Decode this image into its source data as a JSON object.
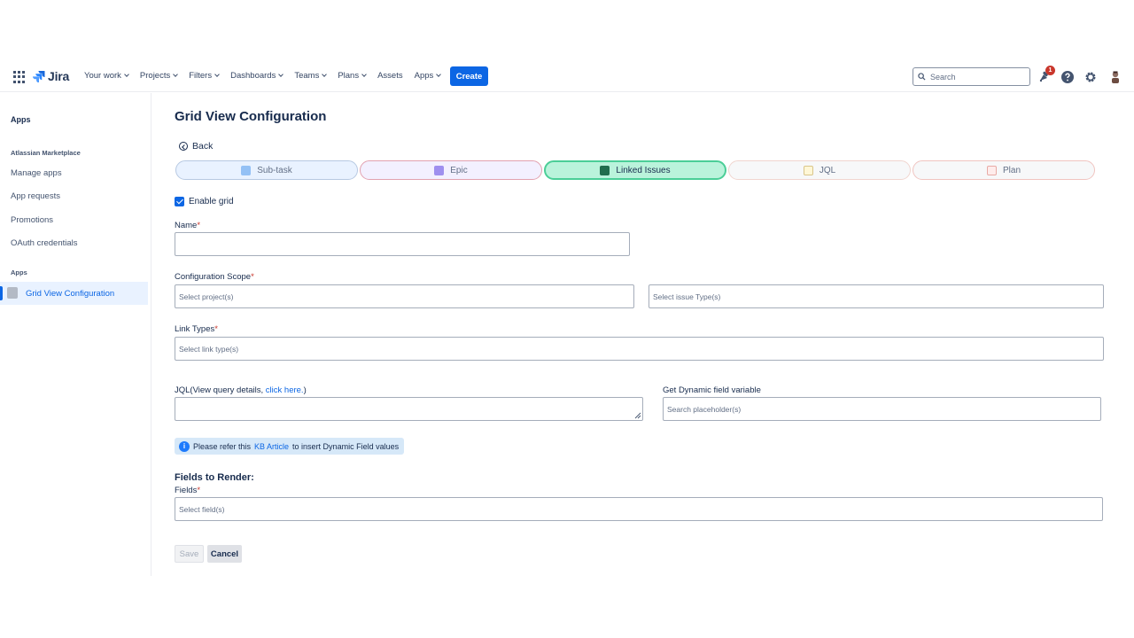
{
  "topnav": {
    "logo_text": "Jira",
    "items": [
      {
        "label": "Your work",
        "caret": true
      },
      {
        "label": "Projects",
        "caret": true
      },
      {
        "label": "Filters",
        "caret": true
      },
      {
        "label": "Dashboards",
        "caret": true
      },
      {
        "label": "Teams",
        "caret": true
      },
      {
        "label": "Plans",
        "caret": true
      },
      {
        "label": "Assets",
        "caret": false
      },
      {
        "label": "Apps",
        "caret": true
      }
    ],
    "create_label": "Create",
    "search_placeholder": "Search",
    "notification_count": "1",
    "icons": [
      "app-switcher-icon",
      "jira-logo-icon",
      "search-icon",
      "notifications-icon",
      "help-icon",
      "settings-icon",
      "avatar"
    ]
  },
  "sidebar": {
    "title": "Apps",
    "marketplace_heading": "Atlassian Marketplace",
    "marketplace_items": [
      "Manage apps",
      "App requests",
      "Promotions",
      "OAuth credentials"
    ],
    "apps_heading": "Apps",
    "active_item": "Grid View Configuration"
  },
  "main": {
    "title": "Grid View Configuration",
    "back_label": "Back",
    "tabs": [
      {
        "label": "Sub-task",
        "icon": "subtask-icon",
        "active": false
      },
      {
        "label": "Epic",
        "icon": "epic-icon",
        "active": false
      },
      {
        "label": "Linked Issues",
        "icon": "linked-issues-icon",
        "active": true
      },
      {
        "label": "JQL",
        "icon": "jql-icon",
        "active": false
      },
      {
        "label": "Plan",
        "icon": "plan-icon",
        "active": false
      }
    ],
    "enable_grid_label": "Enable grid",
    "enable_grid_checked": true,
    "name_label": "Name",
    "name_value": "",
    "scope_label": "Configuration Scope",
    "project_placeholder": "Select project(s)",
    "issue_type_placeholder": "Select issue Type(s)",
    "link_types_label": "Link Types",
    "link_type_placeholder": "Select link type(s)",
    "jql_label_prefix": "JQL(View query details, ",
    "jql_link": "click here.",
    "jql_label_suffix": ")",
    "dynamic_label": "Get Dynamic field variable",
    "dynamic_placeholder": "Search placeholder(s)",
    "info_prefix": "Please refer this ",
    "info_link": "KB Article",
    "info_suffix": " to insert Dynamic Field values",
    "fields_section": "Fields to Render:",
    "fields_label": "Fields",
    "fields_placeholder": "Select field(s)",
    "required_mark": "*",
    "save_label": "Save",
    "cancel_label": "Cancel"
  },
  "colors": {
    "primary": "#0c66e4",
    "tab_subtask": "#e9f2ff",
    "tab_epic": "#f3f0ff",
    "tab_linked_active": "#baf3db",
    "tab_jql": "#fff7d6",
    "tab_plan": "#ffeceb",
    "required": "#c9372c"
  }
}
